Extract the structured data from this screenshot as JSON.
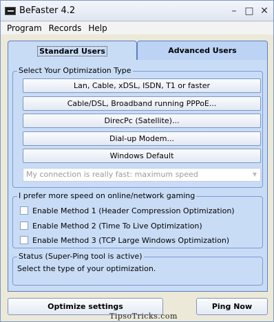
{
  "window": {
    "title": "BeFaster 4.2"
  },
  "title_controls": {
    "minimize": "–",
    "maximize": "□",
    "close": "✕"
  },
  "menu": [
    "Program",
    "Records",
    "Help"
  ],
  "tabs": {
    "standard": "Standard Users",
    "advanced": "Advanced Users"
  },
  "optimization": {
    "legend": "Select Your Optimization Type",
    "buttons": [
      "Lan, Cable, xDSL, ISDN, T1 or faster",
      "Cable/DSL, Broadband running PPPoE...",
      "DirecPc (Satellite)...",
      "Dial-up Modem...",
      "Windows Default"
    ],
    "select_value": "My connection is really fast: maximum speed"
  },
  "gaming": {
    "legend": "I prefer more speed on online/network gaming",
    "options": [
      "Enable Method 1 (Header Compression Optimization)",
      "Enable Method 2 (Time To Live Optimization)",
      "Enable Method 3 (TCP Large Windows Optimization)"
    ]
  },
  "status": {
    "legend": "Status  (Super-Ping tool is active)",
    "text": "Select the type of your optimization."
  },
  "footer": {
    "optimize_label": "Optimize settings",
    "ping_label": "Ping Now",
    "watermark": "TipsoTricks.com"
  }
}
